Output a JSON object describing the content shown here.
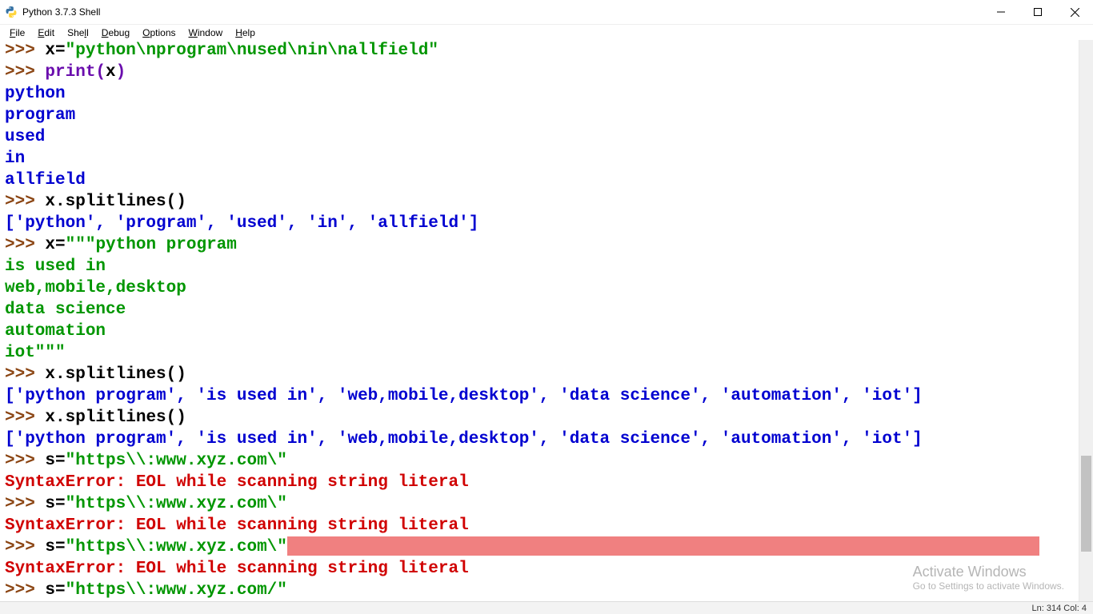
{
  "window": {
    "title": "Python 3.7.3 Shell"
  },
  "menus": {
    "file_html": "<u>F</u>ile",
    "edit_html": "<u>E</u>dit",
    "shell_html": "She<u>l</u>l",
    "debug_html": "<u>D</u>ebug",
    "options_html": "<u>O</u>ptions",
    "window_html": "<u>W</u>indow",
    "help_html": "<u>H</u>elp"
  },
  "status": {
    "text": "Ln: 314  Col: 4"
  },
  "watermark": {
    "title": "Activate Windows",
    "subtitle": "Go to Settings to activate Windows."
  },
  "shell": {
    "prompt": ">>> ",
    "l1_code1": "x=",
    "l1_str": "\"python\\nprogram\\nused\\nin\\nallfield\"",
    "l2_call": "print",
    "l2_par_o": "(",
    "l2_arg": "x",
    "l2_par_c": ")",
    "out_lines_1": "python\nprogram\nused\nin\nallfield",
    "l3_code": "x.splitlines()",
    "out3": "['python', 'program', 'used', 'in', 'allfield']",
    "l4_code1": "x=",
    "l4_str": "\"\"\"python program",
    "l4_cont": "is used in\nweb,mobile,desktop\ndata science\nautomation\niot\"\"\"",
    "l5_code": "x.splitlines()",
    "out5": "['python program', 'is used in', 'web,mobile,desktop', 'data science', 'automation', 'iot']",
    "l6_code": "x.splitlines()",
    "out6": "['python program', 'is used in', 'web,mobile,desktop', 'data science', 'automation', 'iot']",
    "l7_code1": "s=",
    "l7_str": "\"https\\\\:www.xyz.com\\\"",
    "err_a": "SyntaxError: EOL while scanning string literal",
    "l8_code1": "s=",
    "l8_str": "\"https\\\\:www.xyz.com\\\"",
    "err_b": "SyntaxError: EOL while scanning string literal",
    "l9_code1": "s=",
    "l9_str": "\"https\\\\:www.xyz.com\\\"",
    "err_c": "SyntaxError: EOL while scanning string literal",
    "l10_code1": "s=",
    "l10_str": "\"https\\\\:www.xyz.com/\""
  }
}
